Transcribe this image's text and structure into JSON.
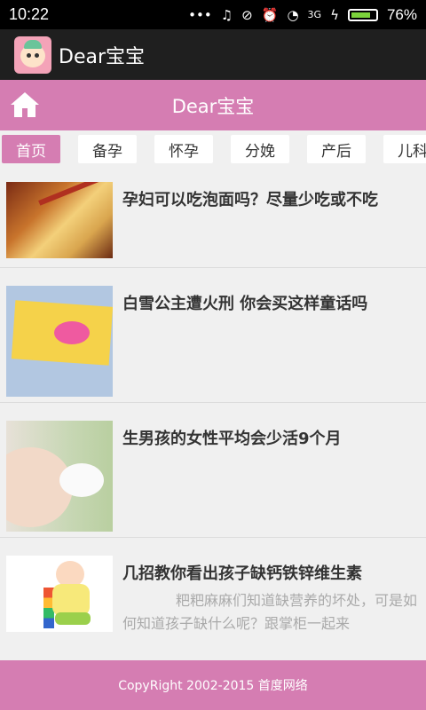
{
  "status_bar": {
    "time": "10:22",
    "network": "3G",
    "battery": "76%"
  },
  "app": {
    "title": "Dear宝宝",
    "icon": "baby-face-icon"
  },
  "header": {
    "title": "Dear宝宝",
    "home_icon": "home-icon"
  },
  "tabs": [
    {
      "label": "首页",
      "active": true
    },
    {
      "label": "备孕"
    },
    {
      "label": "怀孕"
    },
    {
      "label": "分娩"
    },
    {
      "label": "产后"
    },
    {
      "label": "儿科"
    }
  ],
  "articles": [
    {
      "title": "孕妇可以吃泡面吗？尽量少吃或不吃",
      "desc": ""
    },
    {
      "title": "白雪公主遭火刑 你会买这样童话吗",
      "desc": ""
    },
    {
      "title": "生男孩的女性平均会少活9个月",
      "desc": ""
    },
    {
      "title": "几招教你看出孩子缺钙铁锌维生素",
      "desc": "粑粑麻麻们知道缺营养的坏处，可是如何知道孩子缺什么呢？跟掌柜一起来"
    }
  ],
  "footer": {
    "text": "CopyRight 2002-2015 首度网络"
  },
  "colors": {
    "accent": "#d57db2",
    "title_bar": "#1f1f1f"
  }
}
